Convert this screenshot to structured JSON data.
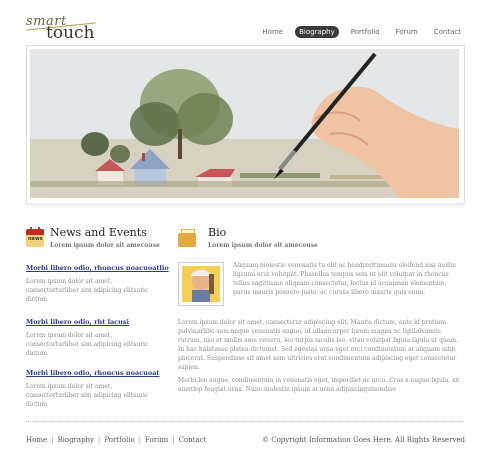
{
  "logo": {
    "line1": "smart",
    "line2": "touch"
  },
  "nav": {
    "items": [
      "Home",
      "Biography",
      "Portfolio",
      "Forum",
      "Contact"
    ],
    "active_index": 1
  },
  "news": {
    "icon_text": "news",
    "title": "News and Events",
    "subtitle": "Lorem ipsum dolor sit amecouse",
    "items": [
      {
        "title": "Morbi libero odio, rhoncus noacuoatlio",
        "desc": "Lorem ipsum dolor sit amet, consectorturliber sim adipicing elitsuric dictum"
      },
      {
        "title": "Morbi libero odio, rht lacusi",
        "desc": "Lorem ipsum dolor sit amet, consectorturliber sim adipicing elitsuric dictum"
      },
      {
        "title": "Morbi libero odio, rhoncus noacuoat",
        "desc": "Lorem ipsum dolor sit amet, consectorturliber sim adipicing elitsuric dictum"
      }
    ]
  },
  "bio": {
    "title": "Bio",
    "subtitle": "Lorem ipsum dolor sit amecouse",
    "para1": "Aliquam molestie venenatis tu elit ac hendreritimaeiu eleifend nisi mollis ligsumi erat volutpat. Phasellus tempus sem ut elit volutpat in rhoncus tellus sagittisme aliquam consectetur, lectus id accumsan elementum, purus mauris posuere justo, ac cursus libero mauris quis enim.",
    "para2": "Lorem ipsum dolor sit amet, consectetur adipiscing elit. Mauris dictum, ante id pretium pulvinarlibo sem neque venenatis augue, id ullamcorper lorem magna ac ligulalvamus rutrum, nisl et mollis ame viverra, leo turpis iaculis leo, vitae volutpat ligula ligula ut quam. In hac habitasse platea dictumst. Sed egestas urna eget orci condimentum at aliquam nibh placerat. Suspendisse sit amet sem ultricies erat condimentum adipiscing eget consectetur sapien.",
    "para3": "Morbi leo augue, condimentum in venenatis eget, imperdiet ac arcu. Cras a augue ligula, sit ametlop feugiat urna. Nunc molestie ipsum at urna adipiscinquisondiso"
  },
  "footer": {
    "nav": [
      "Home",
      "Biography",
      "Portfolio",
      "Forum",
      "Contact"
    ],
    "separator": "|",
    "copyright": "© Copyright Information Goes Here. All Rights Reserved"
  },
  "colors": {
    "accent": "#2b3b8f",
    "nav_active": "#3a3a3a",
    "news_icon": "#c12b1f"
  }
}
